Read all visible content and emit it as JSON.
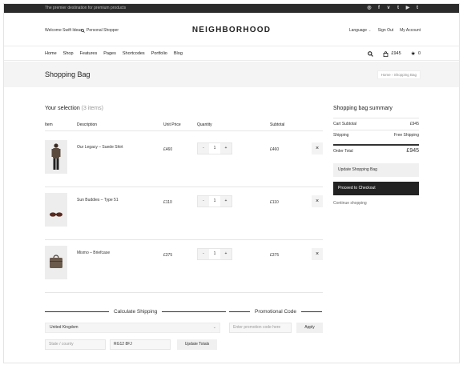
{
  "topbar": {
    "promo": "The premier destination for premium products",
    "socials": [
      {
        "icon": "dribbble-icon",
        "glyph": "◎"
      },
      {
        "icon": "facebook-icon",
        "glyph": "f"
      },
      {
        "icon": "vimeo-icon",
        "glyph": "v"
      },
      {
        "icon": "twitter-icon",
        "glyph": "t"
      },
      {
        "icon": "youtube-icon",
        "glyph": "▶"
      },
      {
        "icon": "tumblr-icon",
        "glyph": "t"
      }
    ]
  },
  "header": {
    "welcome": "Welcome Swift Ideas",
    "shopper": "Personal Shopper",
    "logo": "NEIGHBORHOOD",
    "language": "Language",
    "signout": "Sign Out",
    "account": "My Account"
  },
  "nav": {
    "items": [
      "Home",
      "Shop",
      "Features",
      "Pages",
      "Shortcodes",
      "Portfolio",
      "Blog"
    ],
    "cart_total": "£945",
    "wishlist_count": "0"
  },
  "page": {
    "title": "Shopping Bag",
    "breadcrumb_home": "Home",
    "breadcrumb_sep": "›",
    "breadcrumb_current": "Shopping Bag"
  },
  "cart": {
    "title": "Your selection",
    "count": "(3 items)",
    "headers": {
      "item": "Item",
      "description": "Description",
      "price": "Unit Price",
      "quantity": "Quantity",
      "subtotal": "Subtotal"
    },
    "items": [
      {
        "name": "Our Legacy – Suede Shirt",
        "price": "£460",
        "qty": "1",
        "subtotal": "£460"
      },
      {
        "name": "Sun Buddies – Type 51",
        "price": "£110",
        "qty": "1",
        "subtotal": "£110"
      },
      {
        "name": "Mismo – Briefcase",
        "price": "£375",
        "qty": "1",
        "subtotal": "£375"
      }
    ]
  },
  "summary": {
    "title": "Shopping bag summary",
    "subtotal_label": "Cart Subtotal",
    "subtotal": "£945",
    "shipping_label": "Shipping",
    "shipping": "Free Shipping",
    "total_label": "Order Total",
    "total": "£945",
    "update_label": "Update Shopping Bag",
    "checkout_label": "Proceed to Checkout",
    "continue_label": "Continue shopping"
  },
  "shipping_calc": {
    "title": "Calculate Shipping",
    "country": "United Kingdom",
    "state_placeholder": "State / county",
    "postcode": "RG12 8FJ",
    "update_label": "Update Totals"
  },
  "promo": {
    "title": "Promotional Code",
    "placeholder": "Enter promotion code here",
    "apply_label": "Apply"
  },
  "colors": {
    "dark": "#222222",
    "topbar": "#2b2b2b",
    "light_bg": "#f4f4f4"
  }
}
